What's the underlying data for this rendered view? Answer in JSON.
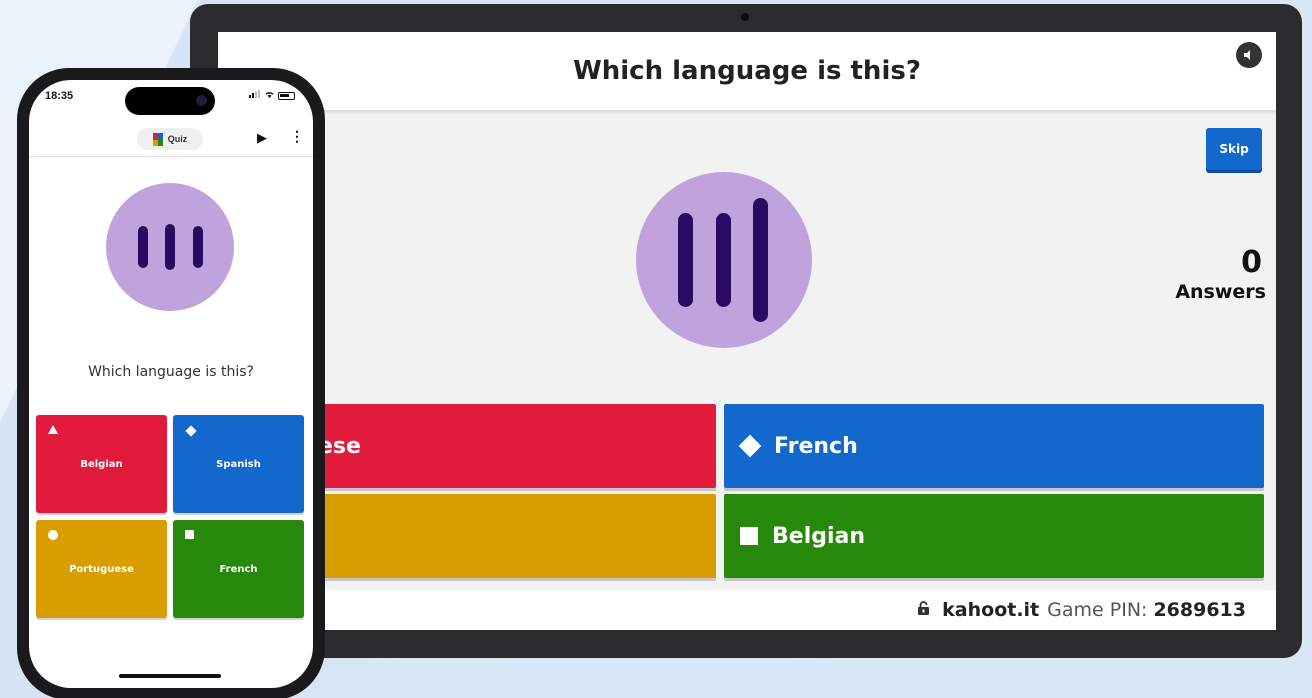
{
  "laptop": {
    "question": "Which language is this?",
    "sound_icon": "speaker-icon",
    "skip_label": "Skip",
    "answers_count": "0",
    "answers_label": "Answers",
    "answers": [
      {
        "label": "ese",
        "color": "#e21b3c",
        "shape": "triangle"
      },
      {
        "label": "French",
        "color": "#1368ce",
        "shape": "diamond"
      },
      {
        "label": "",
        "color": "#d89e00",
        "shape": "circle"
      },
      {
        "label": "Belgian",
        "color": "#26890c",
        "shape": "square"
      }
    ],
    "footer": {
      "site": "kahoot.it",
      "pin_label": "Game PIN:",
      "pin": "2689613"
    }
  },
  "phone": {
    "status_time": "18:35",
    "app_chip": "Quiz",
    "question": "Which language is this?",
    "answers": [
      {
        "label": "Belgian",
        "color": "#e21b3c",
        "shape": "triangle"
      },
      {
        "label": "Spanish",
        "color": "#1368ce",
        "shape": "diamond"
      },
      {
        "label": "Portuguese",
        "color": "#d89e00",
        "shape": "circle"
      },
      {
        "label": "French",
        "color": "#26890c",
        "shape": "square"
      }
    ]
  },
  "colors": {
    "audio_circle": "#c0a3dd",
    "audio_bars": "#2b0a62",
    "skip_button": "#1368ce"
  }
}
